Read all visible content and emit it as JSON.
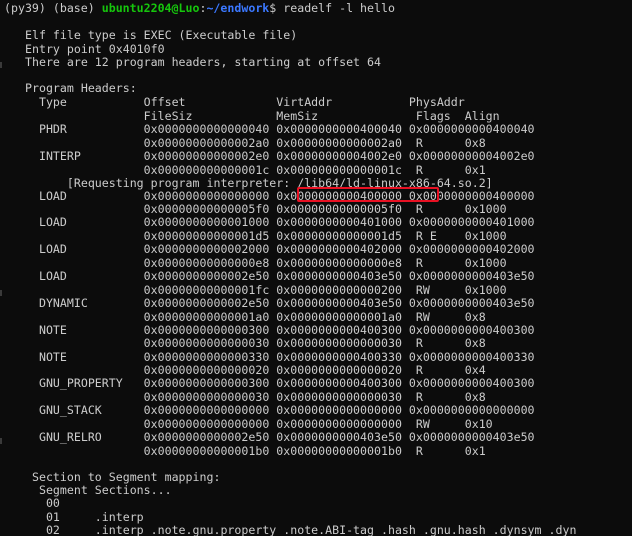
{
  "prompt": {
    "env": "(py39) (base) ",
    "user_host": "ubuntu2204@Luo",
    "separator": ":",
    "path": "~/endwork",
    "dollar": "$ ",
    "command": "readelf -l hello"
  },
  "lines": [
    "Elf file type is EXEC (Executable file)",
    "Entry point 0x4010f0",
    "There are 12 program headers, starting at offset 64",
    "",
    "Program Headers:",
    "  Type           Offset             VirtAddr           PhysAddr",
    "                 FileSiz            MemSiz              Flags  Align",
    "  PHDR           0x0000000000000040 0x0000000000400040 0x0000000000400040",
    "                 0x00000000000002a0 0x00000000000002a0  R      0x8",
    "  INTERP         0x00000000000002e0 0x00000000004002e0 0x00000000004002e0",
    "                 0x000000000000001c 0x000000000000001c  R      0x1",
    "      [Requesting program interpreter: /lib64/ld-linux-x86-64.so.2]",
    "  LOAD           0x0000000000000000 0x0000000000400000 0x0000000000400000",
    "                 0x00000000000005f0 0x00000000000005f0  R      0x1000",
    "  LOAD           0x0000000000001000 0x0000000000401000 0x0000000000401000",
    "                 0x00000000000001d5 0x00000000000001d5  R E    0x1000",
    "  LOAD           0x0000000000002000 0x0000000000402000 0x0000000000402000",
    "                 0x00000000000000e8 0x00000000000000e8  R      0x1000",
    "  LOAD           0x0000000000002e50 0x0000000000403e50 0x0000000000403e50",
    "                 0x00000000000001fc 0x0000000000000200  RW     0x1000",
    "  DYNAMIC        0x0000000000002e50 0x0000000000403e50 0x0000000000403e50",
    "                 0x00000000000001a0 0x00000000000001a0  RW     0x8",
    "  NOTE           0x0000000000000300 0x0000000000400300 0x0000000000400300",
    "                 0x0000000000000030 0x0000000000000030  R      0x8",
    "  NOTE           0x0000000000000330 0x0000000000400330 0x0000000000400330",
    "                 0x0000000000000020 0x0000000000000020  R      0x4",
    "  GNU_PROPERTY   0x0000000000000300 0x0000000000400300 0x0000000000400300",
    "                 0x0000000000000030 0x0000000000000030  R      0x8",
    "  GNU_STACK      0x0000000000000000 0x0000000000000000 0x0000000000000000",
    "                 0x0000000000000000 0x0000000000000000  RW     0x10",
    "  GNU_RELRO      0x0000000000002e50 0x0000000000403e50 0x0000000000403e50",
    "                 0x00000000000001b0 0x00000000000001b0  R      0x1",
    "",
    " Section to Segment mapping:",
    "  Segment Sections...",
    "   00",
    "   01     .interp",
    "   02     .interp .note.gnu.property .note.ABI-tag .hash .gnu.hash .dynsym .dyn"
  ],
  "colors": {
    "background": "#0c0c0c",
    "text": "#cccccc",
    "user": "#16c60c",
    "path": "#3b78ff",
    "highlight": "#e81123"
  }
}
